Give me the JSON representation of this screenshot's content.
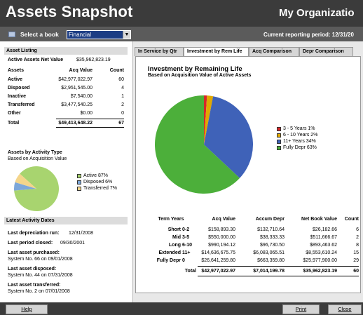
{
  "header": {
    "title": "Assets Snapshot",
    "org": "My Organizatio"
  },
  "toolbar": {
    "select_label": "Select a book",
    "book_value": "Financial",
    "period": "Current reporting period: 12/31/20"
  },
  "listing": {
    "heading": "Asset Listing",
    "net_label": "Active Assets Net Value",
    "net_value": "$35,962,823.19",
    "col_assets": "Assets",
    "col_acq": "Acq Value",
    "col_count": "Count",
    "rows": [
      {
        "name": "Active",
        "value": "$42,977,022.97",
        "count": "60"
      },
      {
        "name": "Disposed",
        "value": "$2,951,545.00",
        "count": "4"
      },
      {
        "name": "Inactive",
        "value": "$7,540.00",
        "count": "1"
      },
      {
        "name": "Transferred",
        "value": "$3,477,540.25",
        "count": "2"
      },
      {
        "name": "Other",
        "value": "$0.00",
        "count": "0"
      }
    ],
    "total": {
      "name": "Total",
      "value": "$49,413,648.22",
      "count": "67"
    }
  },
  "activity": {
    "title": "Assets by Activity Type",
    "subtitle": "Based on Acquisition Value",
    "legend": [
      {
        "label": "Active 87%",
        "color": "#a8d46f"
      },
      {
        "label": "Disposed 6%",
        "color": "#7da7d9"
      },
      {
        "label": "Transferred 7%",
        "color": "#f4d58a"
      }
    ]
  },
  "latest": {
    "heading": "Latest Activity Dates",
    "depr_label": "Last depreciation run:",
    "depr_value": "12/31/2008",
    "closed_label": "Last period closed:",
    "closed_value": "09/30/2001",
    "purchased_label": "Last asset purchased:",
    "purchased_value": "System No. 66 on 09/01/2008",
    "disposed_label": "Last asset disposed:",
    "disposed_value": "System No. 44 on 07/31/2008",
    "transferred_label": "Last asset transferred:",
    "transferred_value": "System No. 2 on 07/01/2008"
  },
  "tabs": [
    "In Service by Qtr",
    "Investment by Rem Life",
    "Acq Comparison",
    "Depr Comparison"
  ],
  "chart": {
    "title": "Investment by Remaining Life",
    "subtitle": "Based on Acquisition Value of Active Assets",
    "legend": [
      {
        "label": "3 - 5 Years 1%",
        "color": "#d62728"
      },
      {
        "label": "6 - 10 Years 2%",
        "color": "#e0a800"
      },
      {
        "label": "11+ Years 34%",
        "color": "#3f62b8"
      },
      {
        "label": "Fully Depr 63%",
        "color": "#4caf3a"
      }
    ]
  },
  "chart_data": {
    "type": "pie",
    "categories": [
      "3 - 5 Years",
      "6 - 10 Years",
      "11+ Years",
      "Fully Depr"
    ],
    "values": [
      1,
      2,
      34,
      63
    ],
    "title": "Investment by Remaining Life"
  },
  "terms": {
    "headers": [
      "Term Years",
      "Acq Value",
      "Accum Depr",
      "Net Book Value",
      "Count"
    ],
    "rows": [
      {
        "name": "Short",
        "range": "0-2",
        "acq": "$158,893.30",
        "depr": "$132,710.64",
        "nbv": "$26,182.66",
        "count": "6"
      },
      {
        "name": "Mid",
        "range": "3-5",
        "acq": "$550,000.00",
        "depr": "$38,333.33",
        "nbv": "$511,666.67",
        "count": "2"
      },
      {
        "name": "Long",
        "range": "6-10",
        "acq": "$990,194.12",
        "depr": "$96,730.50",
        "nbv": "$893,463.62",
        "count": "8"
      },
      {
        "name": "Extended",
        "range": "11+",
        "acq": "$14,636,675.75",
        "depr": "$6,083,065.51",
        "nbv": "$8,553,610.24",
        "count": "15"
      },
      {
        "name": "Fully Depr",
        "range": "0",
        "acq": "$26,641,259.80",
        "depr": "$663,359.80",
        "nbv": "$25,977,900.00",
        "count": "29"
      }
    ],
    "total": {
      "name": "Total",
      "acq": "$42,977,022.97",
      "depr": "$7,014,199.78",
      "nbv": "$35,962,823.19",
      "count": "60"
    }
  },
  "footer": {
    "help": "Help",
    "print": "Print",
    "close": "Close"
  }
}
